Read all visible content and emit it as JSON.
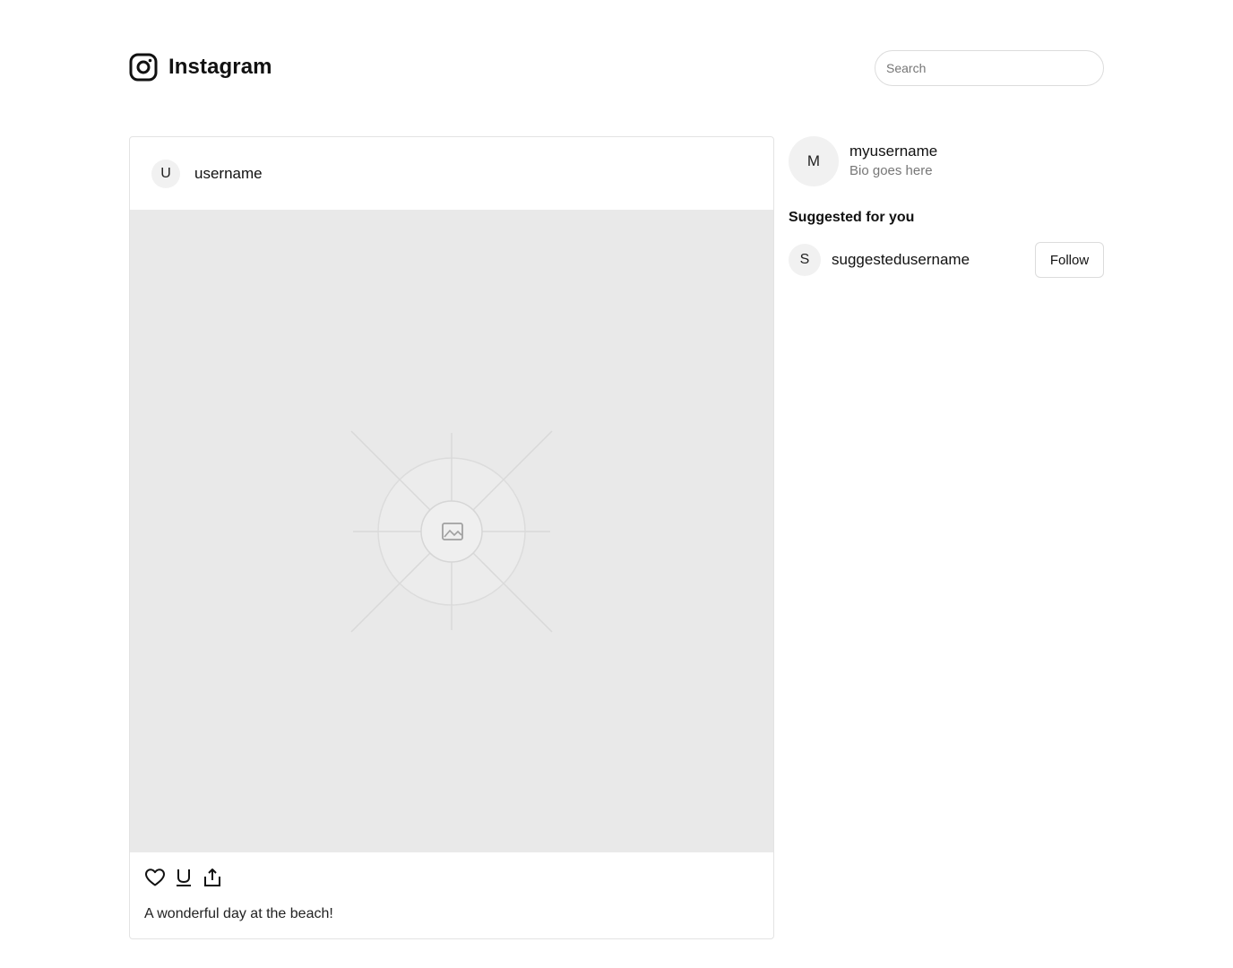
{
  "app": {
    "title": "Instagram",
    "logo_icon": "instagram-logo-icon"
  },
  "search": {
    "placeholder": "Search",
    "value": ""
  },
  "post": {
    "avatar_initial": "U",
    "username": "username",
    "image_icon": "image-placeholder-icon",
    "actions": [
      {
        "name": "like",
        "icon": "heart-icon"
      },
      {
        "name": "comment",
        "icon": "comment-icon"
      },
      {
        "name": "share",
        "icon": "share-icon"
      }
    ],
    "caption": "A wonderful day at the beach!"
  },
  "profile": {
    "avatar_initial": "M",
    "username": "myusername",
    "bio": "Bio goes here"
  },
  "suggestions": {
    "title": "Suggested for you",
    "items": [
      {
        "avatar_initial": "S",
        "username": "suggestedusername",
        "button_label": "Follow"
      }
    ]
  },
  "colors": {
    "background": "#ffffff",
    "image_placeholder": "#e9e9e9",
    "border": "#e3e3e3",
    "muted_text": "#777777"
  }
}
